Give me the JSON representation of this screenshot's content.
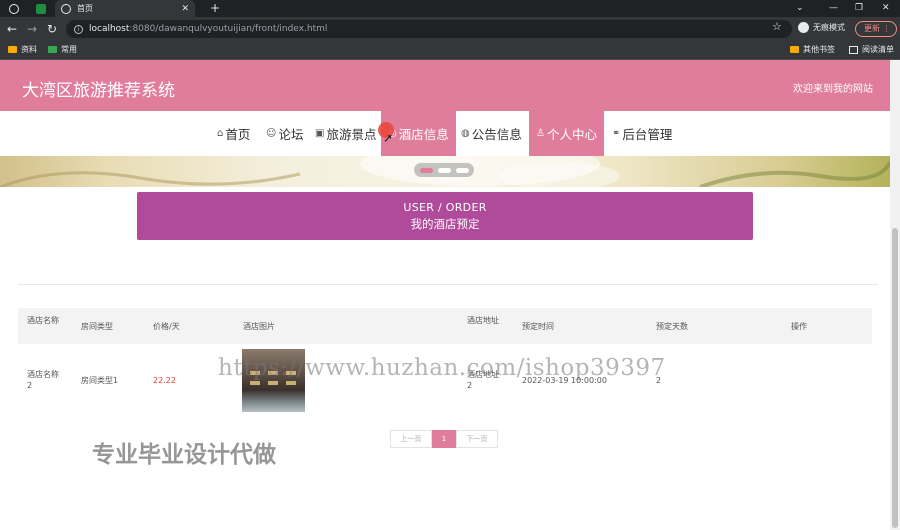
{
  "browser": {
    "tab_title": "首页",
    "url_host": "localhost",
    "url_path": ":8080/dawanqulvyoutuijian/front/index.html",
    "incognito_label": "无痕模式",
    "update_label": "更新",
    "bookmarks": [
      "资料",
      "常用"
    ],
    "bookmarks_right": [
      "其他书签",
      "阅读清单"
    ]
  },
  "header": {
    "title": "大湾区旅游推荐系统",
    "welcome": "欢迎来到我的网站"
  },
  "nav": [
    {
      "icon": "home-icon",
      "glyph": "⌂",
      "label": "首页"
    },
    {
      "icon": "forum-icon",
      "glyph": "☺",
      "label": "论坛"
    },
    {
      "icon": "scenic-icon",
      "glyph": "▣",
      "label": "旅游景点"
    },
    {
      "icon": "hotel-icon",
      "glyph": "◎",
      "label": "酒店信息"
    },
    {
      "icon": "notice-icon",
      "glyph": "◍",
      "label": "公告信息"
    },
    {
      "icon": "user-icon",
      "glyph": "♙",
      "label": "个人中心"
    },
    {
      "icon": "link-icon",
      "glyph": "⚭",
      "label": "后台管理"
    }
  ],
  "order_banner": {
    "en": "USER / ORDER",
    "cn": "我的酒店预定"
  },
  "table": {
    "headers": [
      "酒店名称",
      "房间类型",
      "价格/天",
      "酒店图片",
      "酒店地址",
      "预定时间",
      "预定天数",
      "操作"
    ],
    "rows": [
      {
        "hotel": "酒店名称2",
        "room": "房间类型1",
        "price": "22.22",
        "address": "酒店地址2",
        "time": "2022-03-19 10:00:00",
        "days": "2"
      }
    ]
  },
  "pager": {
    "prev": "上一页",
    "current": "1",
    "next": "下一页"
  },
  "watermarks": {
    "url": "https://www.huzhan.com/ishop39397",
    "text": "专业毕业设计代做"
  },
  "colors": {
    "primary": "#e17d9c",
    "order": "#b04a9b",
    "price": "#e53935"
  }
}
